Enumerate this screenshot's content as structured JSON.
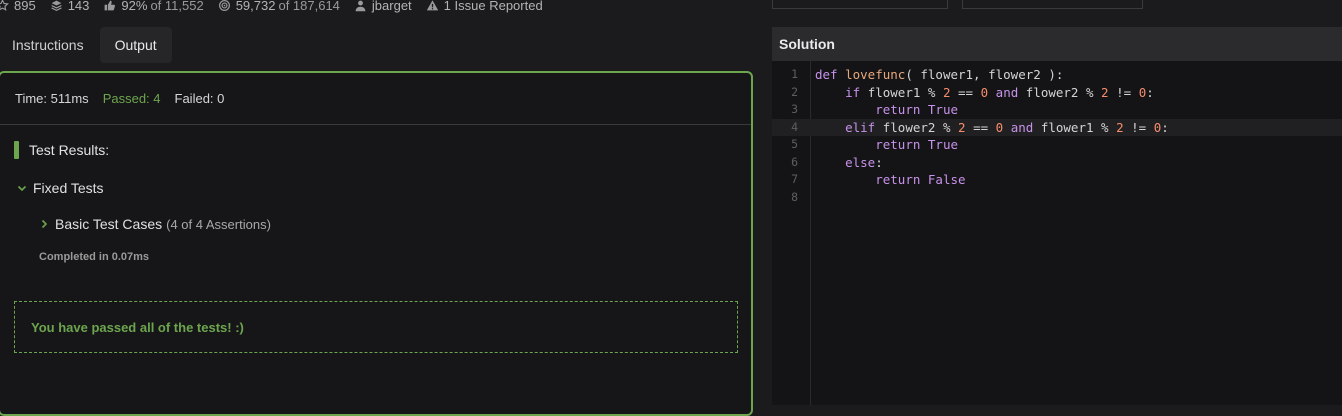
{
  "stats": {
    "stars": "895",
    "collections": "143",
    "satisfaction": "92%",
    "satisfaction_of": "of 11,552",
    "completed": "59,732",
    "completed_of": "of 187,614",
    "author": "jbarget",
    "issues": "1 Issue Reported"
  },
  "tabs": {
    "instructions": "Instructions",
    "output": "Output"
  },
  "summary": {
    "time": "Time: 511ms",
    "passed": "Passed: 4",
    "failed": "Failed: 0"
  },
  "results": {
    "heading": "Test Results:",
    "group": "Fixed Tests",
    "case_name": "Basic Test Cases",
    "case_count": "(4 of 4 Assertions)",
    "completed": "Completed in 0.07ms",
    "pass_message": "You have passed all of the tests! :)"
  },
  "solution": {
    "title": "Solution",
    "line_numbers": [
      "1",
      "2",
      "3",
      "4",
      "5",
      "6",
      "7",
      "8"
    ]
  },
  "icons": [
    "star-icon",
    "stack-icon",
    "thumbs-up-icon",
    "target-icon",
    "user-icon",
    "warning-icon",
    "chevron-down-icon",
    "chevron-right-icon"
  ],
  "colors": {
    "accent": "#6da54f",
    "keyword": "#c792ea",
    "function": "#e8a87c",
    "number": "#f78c6c"
  }
}
